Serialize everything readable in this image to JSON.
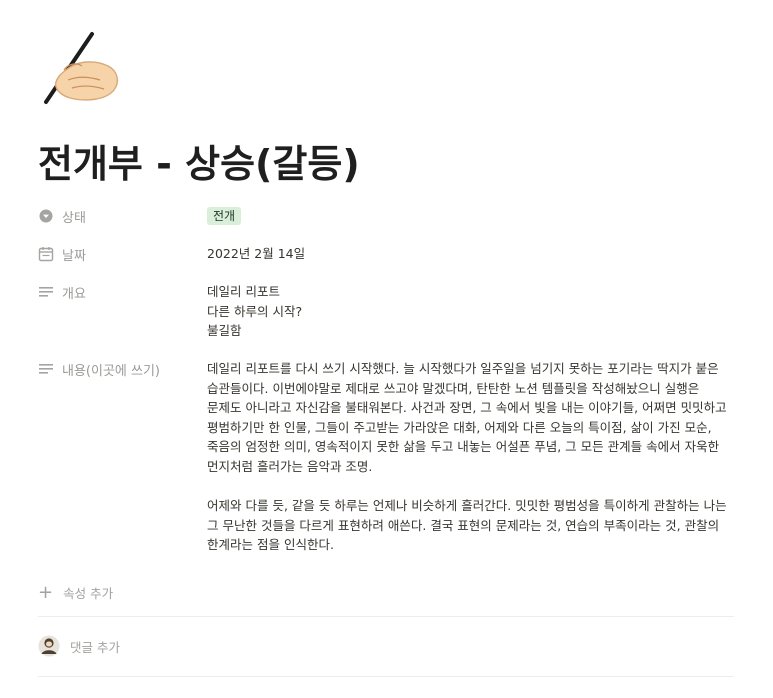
{
  "page": {
    "icon": "writing-hand-emoji",
    "title": "전개부 - 상승(갈등)"
  },
  "properties": {
    "status": {
      "label": "상태",
      "icon": "status-icon",
      "value": "전개",
      "tag_bg": "#dbeddb"
    },
    "date": {
      "label": "날짜",
      "icon": "calendar-icon",
      "value": "2022년 2월 14일"
    },
    "summary": {
      "label": "개요",
      "icon": "text-lines-icon",
      "lines": [
        "데일리 리포트",
        "다른 하루의 시작?",
        "불길함"
      ]
    },
    "content": {
      "label": "내용(이곳에 쓰기)",
      "icon": "text-lines-icon",
      "paragraphs": [
        "데일리 리포트를 다시 쓰기 시작했다. 늘 시작했다가 일주일을 넘기지 못하는 포기라는 딱지가 붙은 습관들이다. 이번에야말로 제대로 쓰고야 말겠다며, 탄탄한 노션 템플릿을 작성해놨으니 실행은 문제도 아니라고 자신감을 불태워본다. 사건과 장면, 그 속에서 빛을 내는 이야기들, 어쩌면 밋밋하고 평범하기만 한 인물, 그들이 주고받는 가라앉은 대화, 어제와 다른 오늘의 특이점, 삶이 가진 모순, 죽음의 엄정한 의미, 영속적이지 못한 삶을 두고 내놓는 어설픈 푸념, 그 모든 관계들 속에서 자욱한 먼지처럼 흘러가는 음악과 조명.",
        "어제와 다를 듯, 같을 듯 하루는 언제나 비슷하게 흘러간다. 밋밋한 평범성을 특이하게 관찰하는 나는 그 무난한 것들을 다르게 표현하려 애쓴다. 결국 표현의 문제라는 것, 연습의 부족이라는 것, 관찰의 한계라는 점을 인식한다."
      ]
    }
  },
  "actions": {
    "add_property": "속성 추가",
    "add_comment": "댓글 추가"
  }
}
